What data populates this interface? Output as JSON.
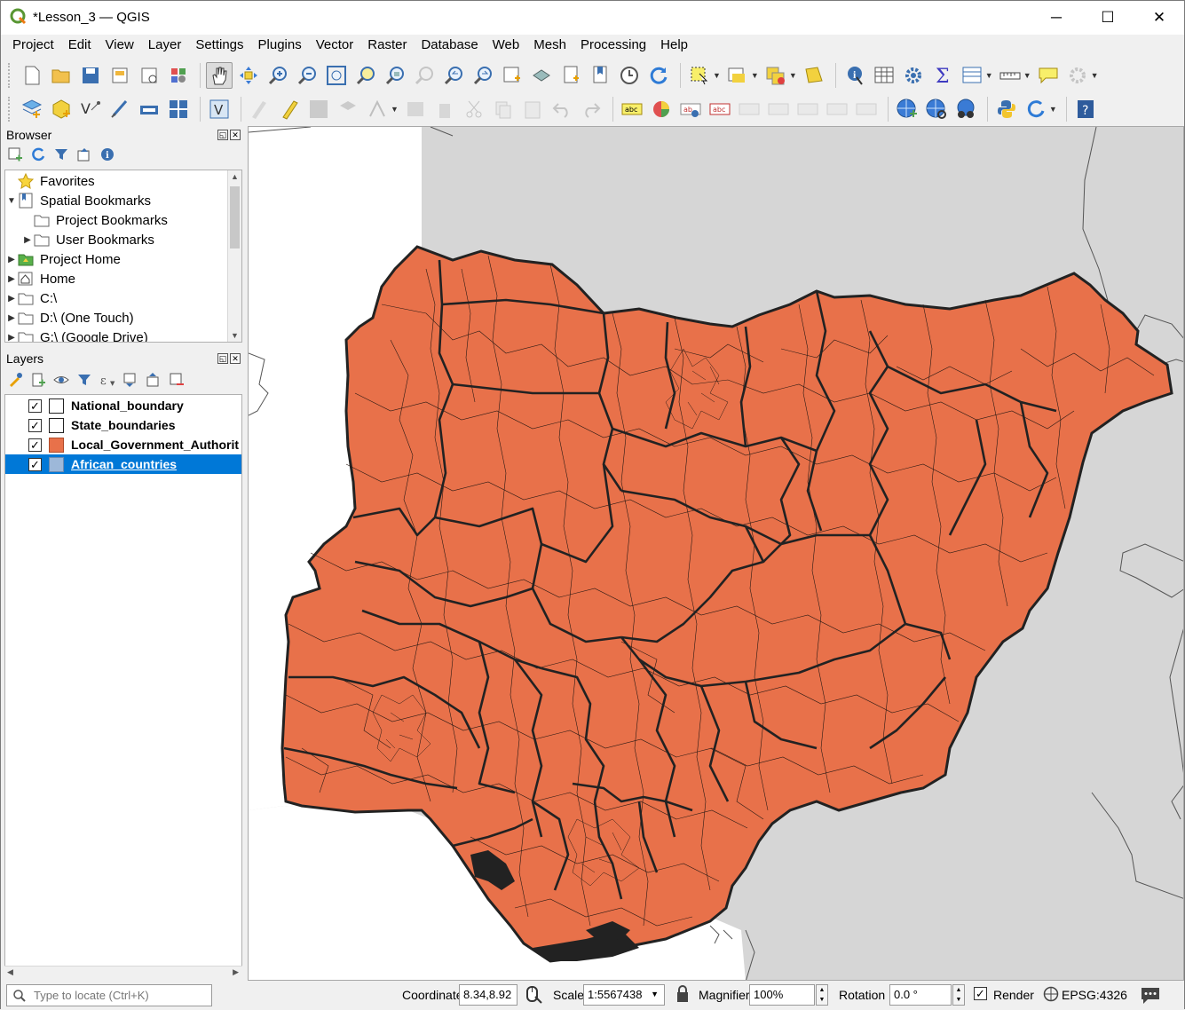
{
  "window": {
    "title": "*Lesson_3 — QGIS",
    "controls": {
      "minimize": "─",
      "maximize": "☐",
      "close": "✕"
    }
  },
  "menubar": [
    "Project",
    "Edit",
    "View",
    "Layer",
    "Settings",
    "Plugins",
    "Vector",
    "Raster",
    "Database",
    "Web",
    "Mesh",
    "Processing",
    "Help"
  ],
  "browser_panel": {
    "title": "Browser",
    "items": [
      {
        "label": "Favorites",
        "icon": "star-icon",
        "indent": 0,
        "expander": ""
      },
      {
        "label": "Spatial Bookmarks",
        "icon": "bookmarks-icon",
        "indent": 0,
        "expander": "▼"
      },
      {
        "label": "Project Bookmarks",
        "icon": "folder-icon",
        "indent": 1,
        "expander": ""
      },
      {
        "label": "User Bookmarks",
        "icon": "folder-icon",
        "indent": 1,
        "expander": "▶"
      },
      {
        "label": "Project Home",
        "icon": "project-home-icon",
        "indent": 0,
        "expander": "▶"
      },
      {
        "label": "Home",
        "icon": "home-icon",
        "indent": 0,
        "expander": "▶"
      },
      {
        "label": "C:\\",
        "icon": "drive-icon",
        "indent": 0,
        "expander": "▶"
      },
      {
        "label": "D:\\ (One Touch)",
        "icon": "drive-icon",
        "indent": 0,
        "expander": "▶"
      },
      {
        "label": "G:\\ (Google Drive)",
        "icon": "drive-icon",
        "indent": 0,
        "expander": "▶"
      }
    ]
  },
  "layers_panel": {
    "title": "Layers",
    "layers": [
      {
        "name": "National_boundary",
        "checked": true,
        "fill": "#ffffff",
        "selected": false
      },
      {
        "name": "State_boundaries",
        "checked": true,
        "fill": "#ffffff",
        "selected": false
      },
      {
        "name": "Local_Government_Authorit",
        "checked": true,
        "fill": "#e8714a",
        "selected": false
      },
      {
        "name": "African_countries",
        "checked": true,
        "fill": "#9db8d9",
        "selected": true
      }
    ]
  },
  "statusbar": {
    "locator_placeholder": "Type to locate (Ctrl+K)",
    "coordinate_label": "Coordinate",
    "coordinate_value": "8.34,8.92",
    "scale_label": "Scale",
    "scale_value": "1:5567438",
    "magnifier_label": "Magnifier",
    "magnifier_value": "100%",
    "rotation_label": "Rotation",
    "rotation_value": "0.0 °",
    "render_label": "Render",
    "render_checked": true,
    "crs": "EPSG:4326"
  },
  "colors": {
    "lga_fill": "#e8714a",
    "country_fill": "#d6d6d6",
    "selection": "#0078d7"
  }
}
